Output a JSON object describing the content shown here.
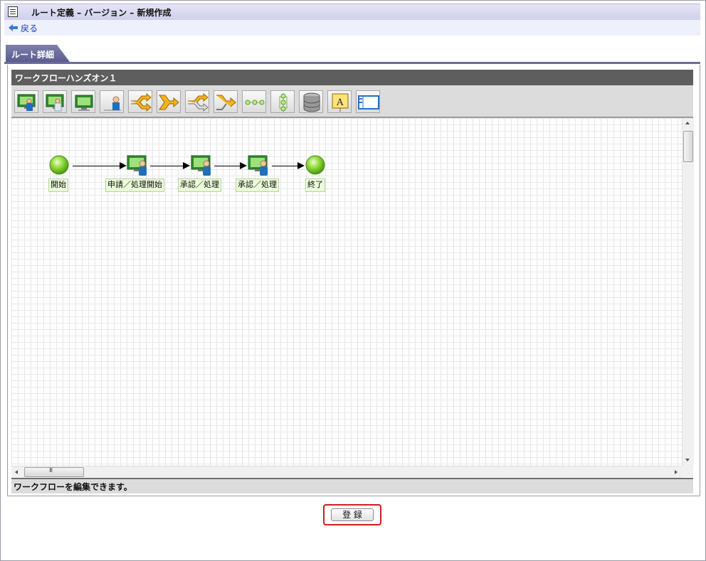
{
  "page": {
    "title": "ルート定義 – バージョン – 新規作成",
    "back_label": "戻る"
  },
  "tab": {
    "label": "ルート詳細"
  },
  "workflow": {
    "name": "ワークフローハンズオン１",
    "status_message": "ワークフローを編集できます。",
    "toolbar_icons": [
      "application-node-icon",
      "approval-node-icon",
      "system-node-icon",
      "user-node-icon",
      "branch-start-icon",
      "branch-end-icon",
      "parallel-start-icon",
      "parallel-end-icon",
      "vertical-line-icon",
      "horizontal-line-icon",
      "database-icon",
      "text-label-icon",
      "window-icon"
    ],
    "nodes": [
      {
        "label": "開始",
        "type": "start"
      },
      {
        "label": "申請／処理開始",
        "type": "task"
      },
      {
        "label": "承認／処理",
        "type": "task"
      },
      {
        "label": "承認／処理",
        "type": "task"
      },
      {
        "label": "終了",
        "type": "end"
      }
    ]
  },
  "actions": {
    "register_label": "登 録"
  },
  "colors": {
    "header_bg": "#cfd0ec",
    "tab_bg": "#6a6c9c",
    "workflow_title_bg": "#5e5e5e",
    "node_green": "#7ed321",
    "highlight_border": "#cc1f1f"
  }
}
